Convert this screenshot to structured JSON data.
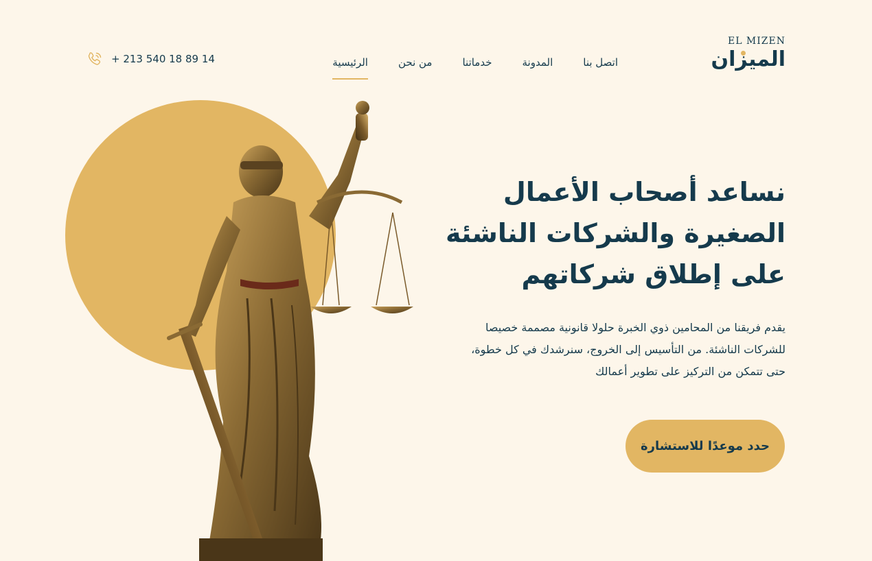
{
  "brand": {
    "latin": "EL  MIZEN",
    "arabic": "الميزان"
  },
  "nav": {
    "items": [
      {
        "label": "الرئيسية",
        "active": true
      },
      {
        "label": "من نحن",
        "active": false
      },
      {
        "label": "خدماتنا",
        "active": false
      },
      {
        "label": "المدونة",
        "active": false
      },
      {
        "label": "اتصل بنا",
        "active": false
      }
    ]
  },
  "contact": {
    "phone": "+ 213 540 18 89 14",
    "icon": "phone-icon"
  },
  "hero": {
    "title": "نساعد أصحاب الأعمال الصغيرة والشركات الناشئة على إطلاق شركاتهم",
    "description": "يقدم فريقنا من المحامين ذوي الخبرة حلولا قانونية مصممة خصيصا للشركات الناشئة. من التأسيس إلى الخروج، سنرشدك في كل خطوة، حتى تتمكن من التركيز على تطوير أعمالك",
    "cta_label": "حدد موعدًا للاستشارة"
  },
  "colors": {
    "background": "#fdf6ea",
    "primary": "#153a4c",
    "accent": "#e2b663",
    "bronze": "#8a6a34"
  }
}
